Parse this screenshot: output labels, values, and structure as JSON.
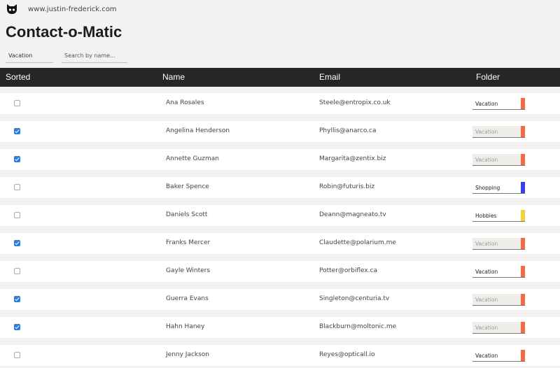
{
  "site_url": "www.justin-frederick.com",
  "app_title": "Contact-o-Matic",
  "filter": {
    "selected": "Vacation"
  },
  "search": {
    "placeholder": "Search by name..."
  },
  "columns": {
    "sorted": "Sorted",
    "name": "Name",
    "email": "Email",
    "folder": "Folder"
  },
  "colors": {
    "Vacation": "#f26b43",
    "Shopping": "#3a3fe8",
    "Hobbies": "#f7cf3c",
    "header_bg": "#262626",
    "checkbox_checked": "#2f7de1"
  },
  "rows": [
    {
      "checked": false,
      "name": "Ana Rosales",
      "email": "Steele@entropix.co.uk",
      "folder": "Vacation",
      "dim": false
    },
    {
      "checked": true,
      "name": "Angelina Henderson",
      "email": "Phyllis@anarco.ca",
      "folder": "Vacation",
      "dim": true
    },
    {
      "checked": true,
      "name": "Annette Guzman",
      "email": "Margarita@zentix.biz",
      "folder": "Vacation",
      "dim": true
    },
    {
      "checked": false,
      "name": "Baker Spence",
      "email": "Robin@futuris.biz",
      "folder": "Shopping",
      "dim": false
    },
    {
      "checked": false,
      "name": "Daniels Scott",
      "email": "Deann@magneato.tv",
      "folder": "Hobbies",
      "dim": false
    },
    {
      "checked": true,
      "name": "Franks Mercer",
      "email": "Claudette@polarium.me",
      "folder": "Vacation",
      "dim": true
    },
    {
      "checked": false,
      "name": "Gayle Winters",
      "email": "Potter@orbiflex.ca",
      "folder": "Vacation",
      "dim": false
    },
    {
      "checked": true,
      "name": "Guerra Evans",
      "email": "Singleton@centuria.tv",
      "folder": "Vacation",
      "dim": true
    },
    {
      "checked": true,
      "name": "Hahn Haney",
      "email": "Blackburn@moltonic.me",
      "folder": "Vacation",
      "dim": true
    },
    {
      "checked": false,
      "name": "Jenny Jackson",
      "email": "Reyes@opticall.io",
      "folder": "Vacation",
      "dim": false
    }
  ]
}
